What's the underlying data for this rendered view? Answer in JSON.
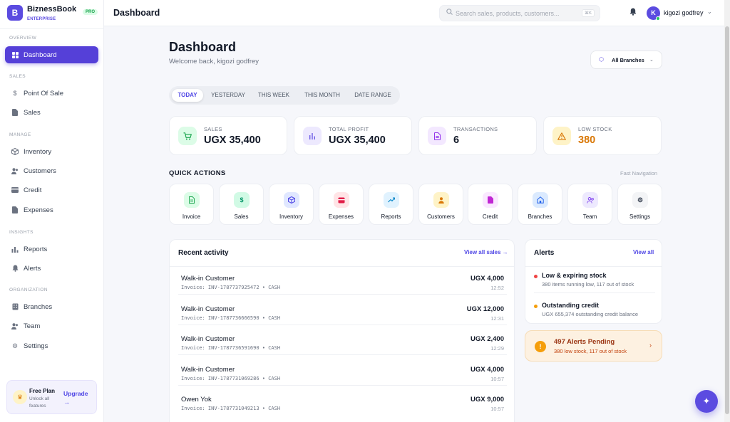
{
  "brand": {
    "logo_letter": "B",
    "name": "BiznessBook",
    "tier": "ENTERPRISE",
    "badge": "PRO",
    "accent": "#5b4be0"
  },
  "sidebar": {
    "sections": [
      {
        "label": "OVERVIEW"
      },
      {
        "label": "SALES"
      },
      {
        "label": "MANAGE"
      },
      {
        "label": "INSIGHTS"
      },
      {
        "label": "ORGANIZATION"
      }
    ],
    "items": [
      {
        "label": "Dashboard",
        "icon": "grid-icon",
        "active": true
      },
      {
        "label": "Point Of Sale",
        "icon": "dollar-icon"
      },
      {
        "label": "Sales",
        "icon": "document-icon"
      },
      {
        "label": "Inventory",
        "icon": "box-icon"
      },
      {
        "label": "Customers",
        "icon": "users-icon"
      },
      {
        "label": "Credit",
        "icon": "credit-card-icon"
      },
      {
        "label": "Expenses",
        "icon": "receipt-icon"
      },
      {
        "label": "Reports",
        "icon": "bar-chart-icon"
      },
      {
        "label": "Alerts",
        "icon": "bell-icon"
      },
      {
        "label": "Branches",
        "icon": "building-icon"
      },
      {
        "label": "Team",
        "icon": "team-icon"
      },
      {
        "label": "Settings",
        "icon": "gear-icon"
      }
    ],
    "plan": {
      "title": "Free Plan",
      "subtitle": "Unlock all features",
      "upgrade": "Upgrade",
      "arrow": "→"
    }
  },
  "topbar": {
    "title": "Dashboard",
    "search_placeholder": "Search sales, products, customers...",
    "shortcut": "⌘K",
    "user": {
      "initial": "K",
      "name": "kigozi godfrey"
    }
  },
  "main": {
    "title": "Dashboard",
    "welcome": "Welcome back, kigozi godfrey",
    "branch_selector": "All Branches",
    "tabs": [
      {
        "label": "TODAY",
        "active": true
      },
      {
        "label": "YESTERDAY"
      },
      {
        "label": "THIS WEEK"
      },
      {
        "label": "THIS MONTH"
      },
      {
        "label": "DATE RANGE"
      }
    ],
    "stats": [
      {
        "label": "SALES",
        "value": "UGX 35,400",
        "icon": "cart-icon",
        "color": "#16a34a",
        "bg": "#dcfce7",
        "value_color": "#111827"
      },
      {
        "label": "TOTAL PROFIT",
        "value": "UGX 35,400",
        "icon": "bar-chart-icon",
        "color": "#6d5be6",
        "bg": "#ede9fe",
        "value_color": "#111827"
      },
      {
        "label": "TRANSACTIONS",
        "value": "6",
        "icon": "document-icon",
        "color": "#9333ea",
        "bg": "#f3e8ff",
        "value_color": "#111827"
      },
      {
        "label": "LOW STOCK",
        "value": "380",
        "icon": "warning-icon",
        "color": "#d97706",
        "bg": "#fef3c7",
        "value_color": "#d97706"
      }
    ],
    "quick_actions": {
      "title": "QUICK ACTIONS",
      "link": "Fast Navigation",
      "items": [
        {
          "label": "Invoice",
          "icon": "invoice-icon",
          "color": "#16a34a",
          "bg": "#dcfce7"
        },
        {
          "label": "Sales",
          "icon": "dollar-icon",
          "color": "#059669",
          "bg": "#d1fae5"
        },
        {
          "label": "Inventory",
          "icon": "box-icon",
          "color": "#4f46e5",
          "bg": "#e0e7ff"
        },
        {
          "label": "Expenses",
          "icon": "wallet-icon",
          "color": "#e11d48",
          "bg": "#ffe4e6"
        },
        {
          "label": "Reports",
          "icon": "trend-icon",
          "color": "#0284c7",
          "bg": "#e0f2fe"
        },
        {
          "label": "Customers",
          "icon": "user-icon",
          "color": "#d97706",
          "bg": "#fef3c7"
        },
        {
          "label": "Credit",
          "icon": "document-icon",
          "color": "#c026d3",
          "bg": "#fae8ff"
        },
        {
          "label": "Branches",
          "icon": "home-icon",
          "color": "#2563eb",
          "bg": "#dbeafe"
        },
        {
          "label": "Team",
          "icon": "team-icon",
          "color": "#7c3aed",
          "bg": "#ede9fe"
        },
        {
          "label": "Settings",
          "icon": "gear-icon",
          "color": "#374151",
          "bg": "#f3f4f6"
        }
      ]
    },
    "recent_activity": {
      "title": "Recent activity",
      "link": "View all sales →",
      "rows": [
        {
          "name": "Walk-in Customer",
          "invoice": "Invoice: INV-1787737925472 • CASH",
          "amount": "UGX 4,000",
          "time": "12:52"
        },
        {
          "name": "Walk-in Customer",
          "invoice": "Invoice: INV-1787736666590 • CASH",
          "amount": "UGX 12,000",
          "time": "12:31"
        },
        {
          "name": "Walk-in Customer",
          "invoice": "Invoice: INV-1787736591690 • CASH",
          "amount": "UGX 2,400",
          "time": "12:29"
        },
        {
          "name": "Walk-in Customer",
          "invoice": "Invoice: INV-1787731069286 • CASH",
          "amount": "UGX 4,000",
          "time": "10:57"
        },
        {
          "name": "Owen Yok",
          "invoice": "Invoice: INV-1787731049213 • CASH",
          "amount": "UGX 9,000",
          "time": "10:57"
        }
      ]
    },
    "alerts": {
      "title": "Alerts",
      "link": "View all",
      "items": [
        {
          "title": "Low & expiring stock",
          "detail": "380 items running low, 117 out of stock",
          "color": "#ef4444"
        },
        {
          "title": "Outstanding credit",
          "detail": "UGX 655,374 outstanding credit balance",
          "color": "#f59e0b"
        }
      ],
      "pending": {
        "title": "497 Alerts Pending",
        "detail": "380 low stock, 117 out of stock"
      }
    }
  }
}
